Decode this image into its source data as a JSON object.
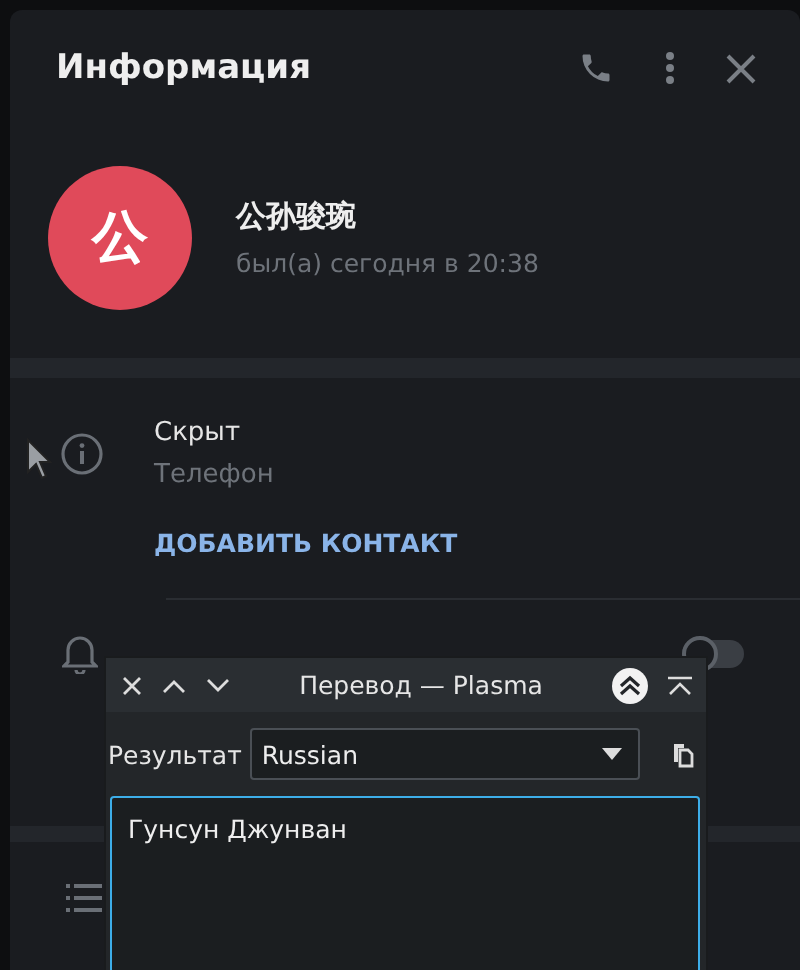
{
  "header": {
    "title": "Информация"
  },
  "profile": {
    "avatar_letter": "公",
    "name": "公孙骏琬",
    "status": "был(а) сегодня в 20:38"
  },
  "info": {
    "value": "Скрыт",
    "label": "Телефон",
    "action": "ДОБАВИТЬ КОНТАКТ"
  },
  "notifications_toggle": {
    "on": false
  },
  "popup": {
    "title": "Перевод — Plasma",
    "result_label": "Результат",
    "language": "Russian",
    "output": "Гунсун Джунван"
  }
}
